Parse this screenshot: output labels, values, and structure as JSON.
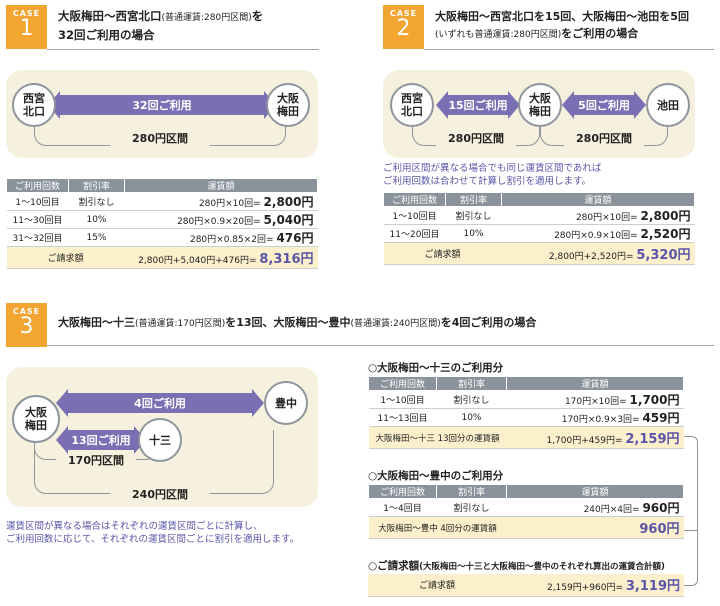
{
  "case1": {
    "label": "CASE",
    "num": "1",
    "title1": "大阪梅田～西宮北口",
    "title1_small": "(普通運賃:280円区間)",
    "title1_end": "を",
    "title2": "32回ご利用の場合",
    "station_a": "西宮\n北口",
    "station_b": "大阪\n梅田",
    "arrow": "32回ご利用",
    "range": "280円区間",
    "headers": [
      "ご利用回数",
      "割引率",
      "運賃額"
    ],
    "rows": [
      [
        "1～10回目",
        "割引なし",
        "280円×10回=",
        "2,800円"
      ],
      [
        "11～30回目",
        "10%",
        "280円×0.9×20回=",
        "5,040円"
      ],
      [
        "31～32回目",
        "15%",
        "280円×0.85×2回=",
        "476円"
      ]
    ],
    "total_label": "ご請求額",
    "total_calc": "2,800円+5,040円+476円=",
    "total": "8,316円"
  },
  "case2": {
    "label": "CASE",
    "num": "2",
    "title1": "大阪梅田～西宮北口を15回、大阪梅田～池田を5回",
    "title2_small": "(いずれも普通運賃:280円区間)",
    "title2_end": "をご利用の場合",
    "station_a": "西宮\n北口",
    "station_b": "大阪\n梅田",
    "station_c": "池田",
    "arrow1": "15回ご利用",
    "arrow2": "5回ご利用",
    "range1": "280円区間",
    "range2": "280円区間",
    "note": "ご利用区間が異なる場合でも同じ運賃区間であれば\nご利用回数は合わせて計算し割引を適用します。",
    "headers": [
      "ご利用回数",
      "割引率",
      "運賃額"
    ],
    "rows": [
      [
        "1～10回目",
        "割引なし",
        "280円×10回=",
        "2,800円"
      ],
      [
        "11～20回目",
        "10%",
        "280円×0.9×10回=",
        "2,520円"
      ]
    ],
    "total_label": "ご請求額",
    "total_calc": "2,800円+2,520円=",
    "total": "5,320円"
  },
  "case3": {
    "label": "CASE",
    "num": "3",
    "title_a": "大阪梅田～十三",
    "title_a_small": "(普通運賃:170円区間)",
    "title_b": "を13回、大阪梅田～豊中",
    "title_b_small": "(普通運賃:240円区間)",
    "title_c": "を4回ご利用の場合",
    "station_a": "大阪\n梅田",
    "station_b": "十三",
    "station_c": "豊中",
    "arrow1": "4回ご利用",
    "arrow2": "13回ご利用",
    "range1": "170円区間",
    "range2": "240円区間",
    "note": "運賃区間が異なる場合はそれぞれの運賃区間ごとに計算し、\nご利用回数に応じて、それぞれの運賃区間ごとに割引を適用します。",
    "sub1": "○大阪梅田～十三のご利用分",
    "sub2": "○大阪梅田～豊中のご利用分",
    "sub3": "○ご請求額",
    "sub3_small": "(大阪梅田～十三と大阪梅田～豊中のそれぞれ算出の運賃合計額)",
    "headers": [
      "ご利用回数",
      "割引率",
      "運賃額"
    ],
    "t1_rows": [
      [
        "1～10回目",
        "割引なし",
        "170円×10回=",
        "1,700円"
      ],
      [
        "11～13回目",
        "10%",
        "170円×0.9×3回=",
        "459円"
      ]
    ],
    "t1_total_label": "大阪梅田～十三 13回分の運賃額",
    "t1_total_calc": "1,700円+459円=",
    "t1_total": "2,159円",
    "t2_rows": [
      [
        "1～4回目",
        "割引なし",
        "240円×4回=",
        "960円"
      ]
    ],
    "t2_total_label": "大阪梅田～豊中 4回分の運賃額",
    "t2_total": "960円",
    "t3_label": "ご請求額",
    "t3_calc": "2,159円+960円=",
    "t3_total": "3,119円"
  },
  "colors": {
    "badge": "#f3a531",
    "accent": "#7b6fb3",
    "total_text": "#5a55a8",
    "total_bg": "#fbefcc",
    "header": "#8a939b",
    "diagram_bg": "#f6f1de"
  }
}
